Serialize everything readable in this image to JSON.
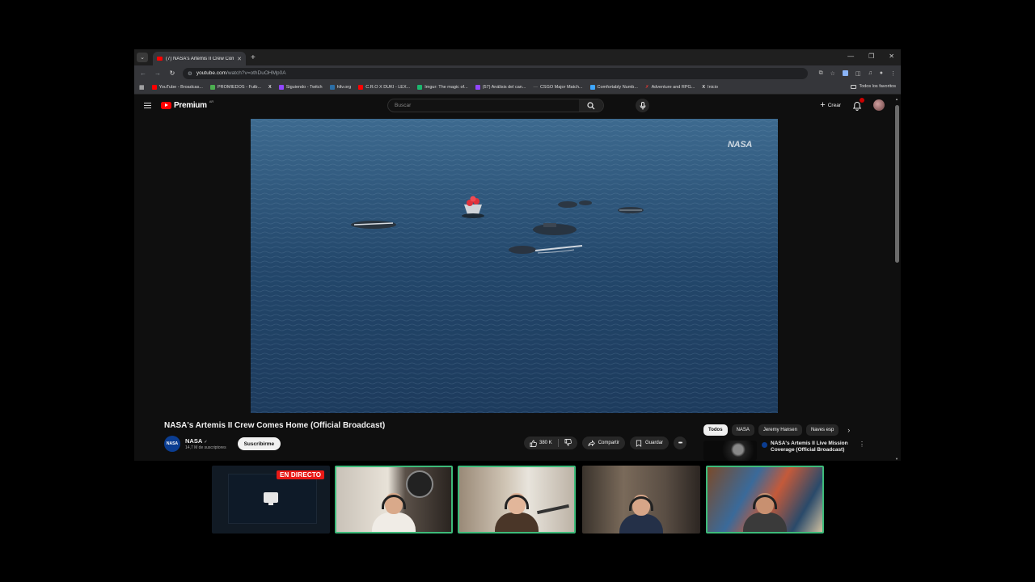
{
  "browser": {
    "tab_title": "(7) NASA's Artemis II Crew Com",
    "url_host": "youtube.com",
    "url_path": "/watch?v=othDuOHMp0A",
    "bookmarks": [
      {
        "label": "YouTube - Broadcas...",
        "color": "#ff0000"
      },
      {
        "label": "PROMIEDOS - Futb...",
        "color": "#4caf50"
      },
      {
        "label": "X",
        "color": "#ffffff"
      },
      {
        "label": "Siguiendo - Twitch",
        "color": "#9146ff"
      },
      {
        "label": "hltv.org",
        "color": "#2b6ea6"
      },
      {
        "label": "C.R.O X DUKI - LEX...",
        "color": "#ff0000"
      },
      {
        "label": "Imgur: The magic of...",
        "color": "#1bb76e"
      },
      {
        "label": "(57) Análisis del can...",
        "color": "#9146ff"
      },
      {
        "label": "CSGO Major Match...",
        "color": "#888888"
      },
      {
        "label": "Comfortably Numb...",
        "color": "#3ea6ff"
      },
      {
        "label": "Adventure and RPG...",
        "color": "#e53935"
      },
      {
        "label": "Inicio",
        "color": "#ffffff"
      }
    ],
    "all_bookmarks": "Todos los favoritos"
  },
  "youtube": {
    "logo_text": "Premium",
    "country_code": "AR",
    "search_placeholder": "Buscar",
    "create_label": "Crear",
    "notification_count": "9+"
  },
  "video": {
    "watermark": "NASA",
    "title": "NASA's Artemis II Crew Comes Home (Official Broadcast)",
    "channel_name": "NASA",
    "subscribers": "14,7 M de suscriptores",
    "subscribe_label": "Suscribirme",
    "likes": "380 K",
    "share_label": "Compartir",
    "save_label": "Guardar"
  },
  "sidebar": {
    "chips": [
      "Todos",
      "NASA",
      "Jeremy Hansen",
      "Naves esp"
    ],
    "rec_title": "NASA's Artemis II Live Mission Coverage (Official Broadcast)"
  },
  "stream": {
    "live_label": "EN DIRECTO"
  },
  "colors": {
    "accent": "#ff0000",
    "cam_highlight": "#3dbb7a",
    "live_red": "#e91916",
    "ocean": "#24486a"
  }
}
